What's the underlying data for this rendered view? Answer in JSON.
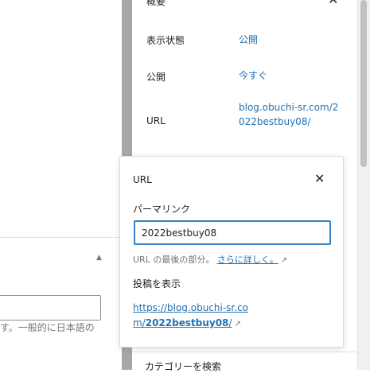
{
  "summary": {
    "title": "概要",
    "rows": [
      {
        "label": "表示状態",
        "value": "公開"
      },
      {
        "label": "公開",
        "value": "今すぐ"
      },
      {
        "label": "URL",
        "value": "blog.obuchi-sr.com/2022bestbuy08/"
      }
    ]
  },
  "left": {
    "help_text": "す。一般的に日本語の"
  },
  "popover": {
    "title": "URL",
    "permalink_label": "パーマリンク",
    "slug_value": "2022bestbuy08",
    "help_prefix": "URL の最後の部分。",
    "help_link": "さらに詳しく。",
    "view_post_label": "投稿を表示",
    "post_url_prefix": "https://blog.obuchi-sr.com/",
    "post_url_slug": "2022bestbuy08",
    "post_url_suffix": "/"
  },
  "sidebar_bottom": {
    "category_search": "カテゴリーを検索"
  },
  "icons": {
    "close": "close-icon",
    "external": "external-link-icon",
    "caret": "caret-up-icon"
  },
  "colors": {
    "link": "#2271b1",
    "focus": "#3582c4"
  }
}
